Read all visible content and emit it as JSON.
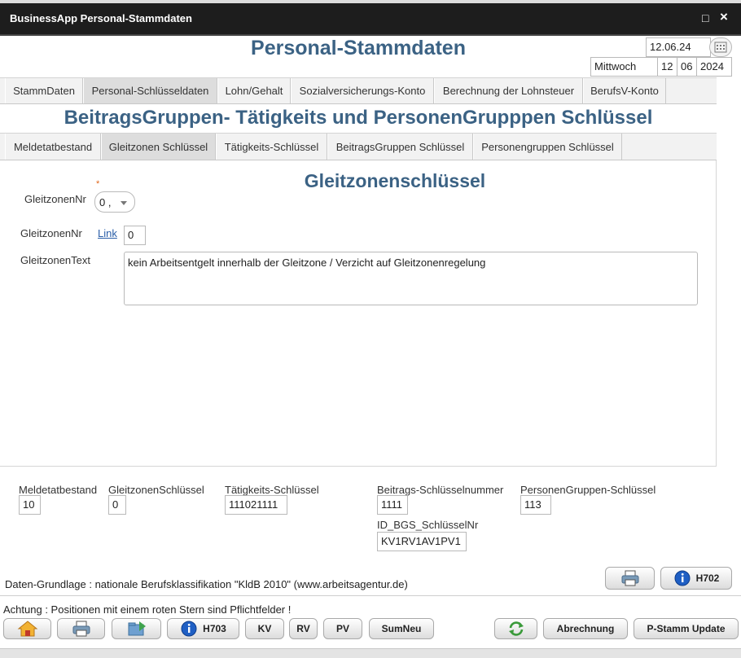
{
  "window": {
    "title": "BusinessApp Personal-Stammdaten",
    "maximize_glyph": "□",
    "close_glyph": "×"
  },
  "header": {
    "title": "Personal-Stammdaten",
    "date": "12.06.24",
    "weekday": "Mittwoch",
    "day": "12",
    "month": "06",
    "year": "2024"
  },
  "main_tabs": [
    {
      "label": "StammDaten",
      "active": false
    },
    {
      "label": "Personal-Schlüsseldaten",
      "active": true
    },
    {
      "label": "Lohn/Gehalt",
      "active": false
    },
    {
      "label": "Sozialversicherungs-Konto",
      "active": false
    },
    {
      "label": "Berechnung der Lohnsteuer",
      "active": false
    },
    {
      "label": "BerufsV-Konto",
      "active": false
    }
  ],
  "section": {
    "title": "BeitragsGruppen- Tätigkeits und PersonenGrupppen Schlüssel"
  },
  "sub_tabs": [
    {
      "label": "Meldetatbestand",
      "active": false
    },
    {
      "label": "Gleitzonen Schlüssel",
      "active": true
    },
    {
      "label": "Tätigkeits-Schlüssel",
      "active": false
    },
    {
      "label": "BeitragsGruppen Schlüssel",
      "active": false
    },
    {
      "label": "Personengruppen Schlüssel",
      "active": false
    }
  ],
  "form": {
    "title": "Gleitzonenschlüssel",
    "required_mark": "*",
    "gleitzonen_nr_select_label": "GleitzonenNr",
    "gleitzonen_nr_select_value": "0 ,",
    "gleitzonen_nr_label": "GleitzonenNr",
    "link_label": "Link",
    "gleitzonen_nr_value": "0",
    "gleitzonen_text_label": "GleitzonenText",
    "gleitzonen_text_value": "kein Arbeitsentgelt innerhalb der Gleitzone / Verzicht auf Gleitzonenregelung"
  },
  "summary": {
    "meldetatbestand": {
      "label": "Meldetatbestand",
      "value": "10"
    },
    "gleitzonenschluessel": {
      "label": "GleitzonenSchlüssel",
      "value": "0"
    },
    "taetigkeitsschluessel": {
      "label": "Tätigkeits-Schlüssel",
      "value": "111021111"
    },
    "beitragsschluesselnummer": {
      "label": "Beitrags-Schlüsselnummer",
      "value": "1111"
    },
    "personengruppenschluessel": {
      "label": "PersonenGruppen-Schlüssel",
      "value": "113"
    },
    "id_bgs_schluesselnr": {
      "label": "ID_BGS_SchlüsselNr",
      "value": "KV1RV1AV1PV1"
    }
  },
  "info_line": "Daten-Grundlage : nationale Berufsklassifikation \"KldB 2010\" (www.arbeitsagentur.de)",
  "info_buttons": {
    "h702": "H702"
  },
  "footer": {
    "note": "Achtung : Positionen mit einem roten Stern sind Pflichtfelder !",
    "h703": "H703",
    "kv": "KV",
    "rv": "RV",
    "pv": "PV",
    "sumneu": "SumNeu",
    "abrechnung": "Abrechnung",
    "pstamm_update": "P-Stamm Update"
  },
  "colors": {
    "title_blue": "#3b6284",
    "titlebar": "#1d1d1d",
    "required": "#e0661a",
    "link": "#2a5ea8"
  }
}
